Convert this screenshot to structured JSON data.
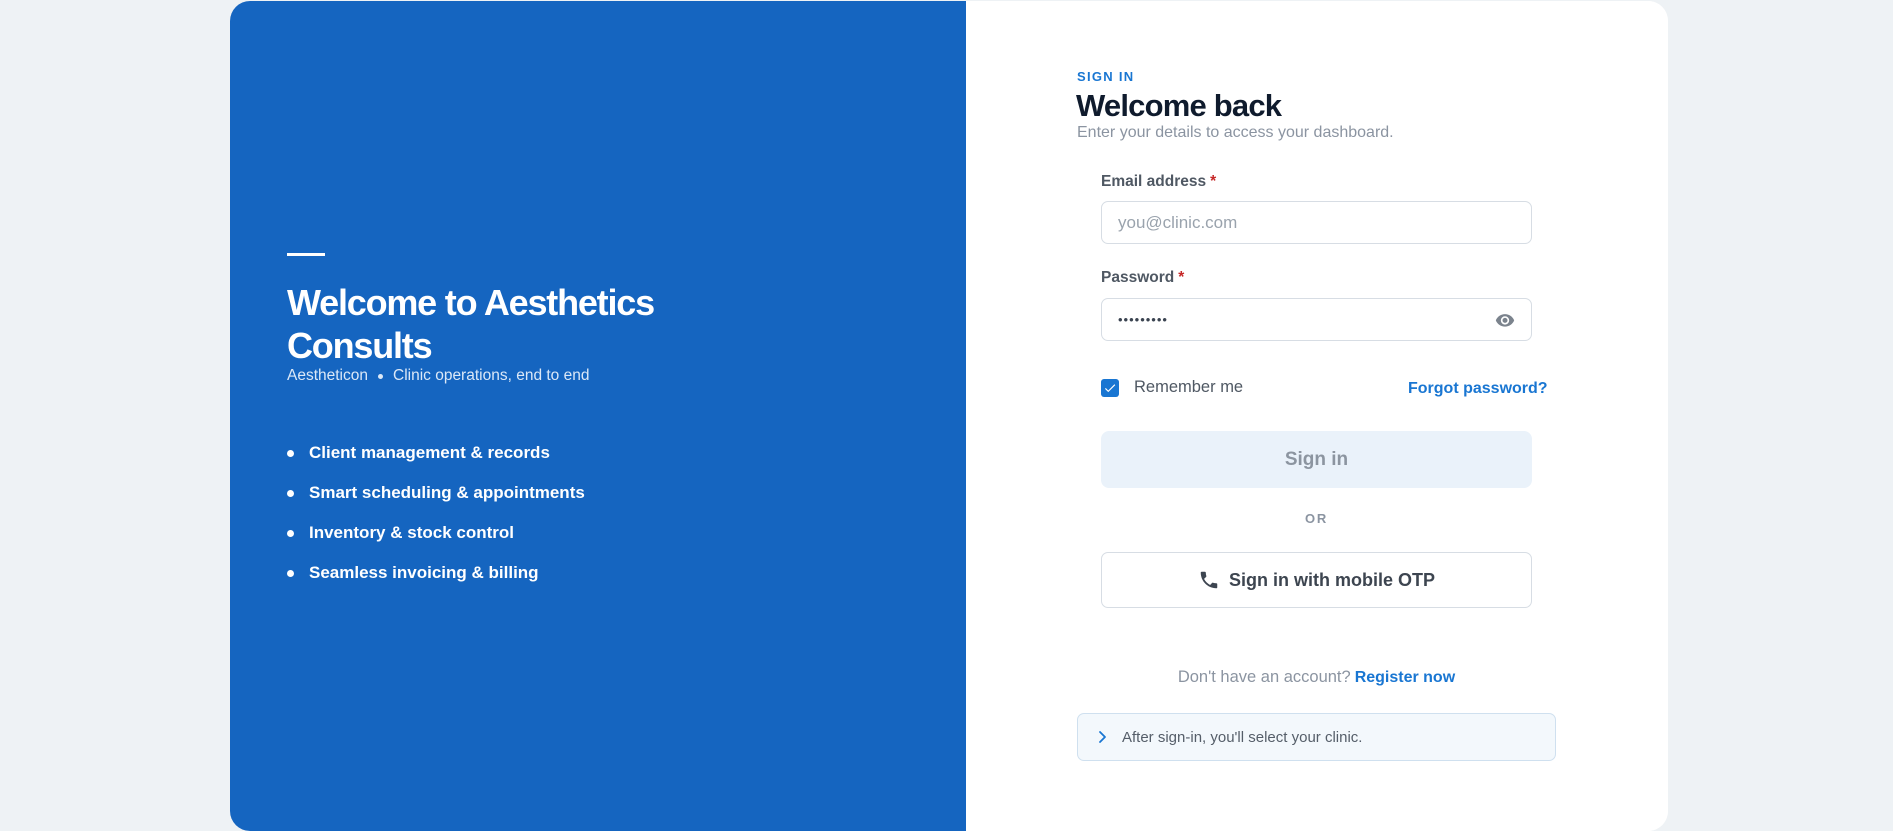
{
  "hero": {
    "title": "Welcome to Aesthetics Consults",
    "brand": "Aestheticon",
    "tagline": "Clinic operations, end to end",
    "features": [
      "Client management & records",
      "Smart scheduling & appointments",
      "Inventory & stock control",
      "Seamless invoicing & billing"
    ]
  },
  "form": {
    "eyebrow": "SIGN IN",
    "title": "Welcome back",
    "subtitle": "Enter your details to access your dashboard.",
    "email": {
      "label": "Email address",
      "required_mark": "*",
      "placeholder": "you@clinic.com",
      "value": ""
    },
    "password": {
      "label": "Password",
      "required_mark": "*",
      "value": "•••••••••"
    },
    "remember": {
      "label": "Remember me",
      "checked": true
    },
    "forgot_label": "Forgot password?",
    "signin_label": "Sign in",
    "or_label": "OR",
    "otp_label": "Sign in with mobile OTP",
    "register_prompt": "Don't have an account?",
    "register_link": "Register now",
    "notice": "After sign-in, you'll select your clinic."
  },
  "colors": {
    "brand_blue": "#1565c0",
    "accent": "#1976d2",
    "required": "#c62828",
    "page_bg": "#eef2f5"
  },
  "icons": [
    "eye-icon",
    "check-icon",
    "phone-icon",
    "chevron-right-icon"
  ]
}
